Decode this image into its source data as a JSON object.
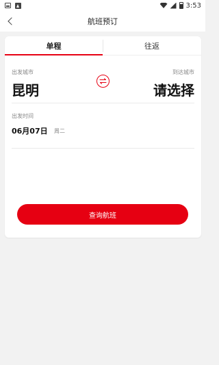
{
  "status_bar": {
    "time": "3:53",
    "left_icons": [
      "notification-image-icon",
      "notification-app-icon"
    ],
    "right_icons": [
      "wifi-icon",
      "signal-icon",
      "battery-icon"
    ]
  },
  "header": {
    "title": "航班预订",
    "back_icon": "back-arrow-icon"
  },
  "tabs": [
    {
      "label": "单程",
      "active": true
    },
    {
      "label": "往返",
      "active": false
    }
  ],
  "route": {
    "from_label": "出发城市",
    "from_city": "昆明",
    "to_label": "到达城市",
    "to_city": "请选择",
    "swap_icon": "swap-arrows-icon"
  },
  "departure": {
    "label": "出发时间",
    "date": "06月07日",
    "weekday": "周二"
  },
  "search_button": {
    "label": "查询航班"
  },
  "colors": {
    "accent": "#e60012",
    "background": "#f2f2f2",
    "card": "#ffffff"
  }
}
